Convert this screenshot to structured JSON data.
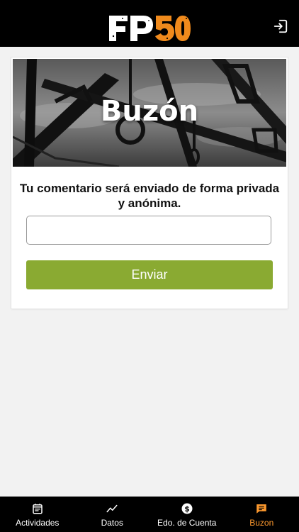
{
  "header": {
    "logo_text": "FP50",
    "logout_icon": "logout-icon"
  },
  "banner": {
    "title": "Buzón"
  },
  "form": {
    "message": "Tu comentario será enviado de forma privada y anónima.",
    "input_value": "",
    "input_placeholder": "",
    "send_label": "Enviar"
  },
  "tabs": [
    {
      "label": "Actividades",
      "icon": "calendar-icon",
      "active": false
    },
    {
      "label": "Datos",
      "icon": "trend-chart-icon",
      "active": false
    },
    {
      "label": "Edo. de Cuenta",
      "icon": "dollar-circle-icon",
      "active": false
    },
    {
      "label": "Buzon",
      "icon": "message-bubble-icon",
      "active": true
    }
  ],
  "colors": {
    "accent": "#ff9a2e",
    "button": "#8aaa32",
    "header": "#000000"
  }
}
